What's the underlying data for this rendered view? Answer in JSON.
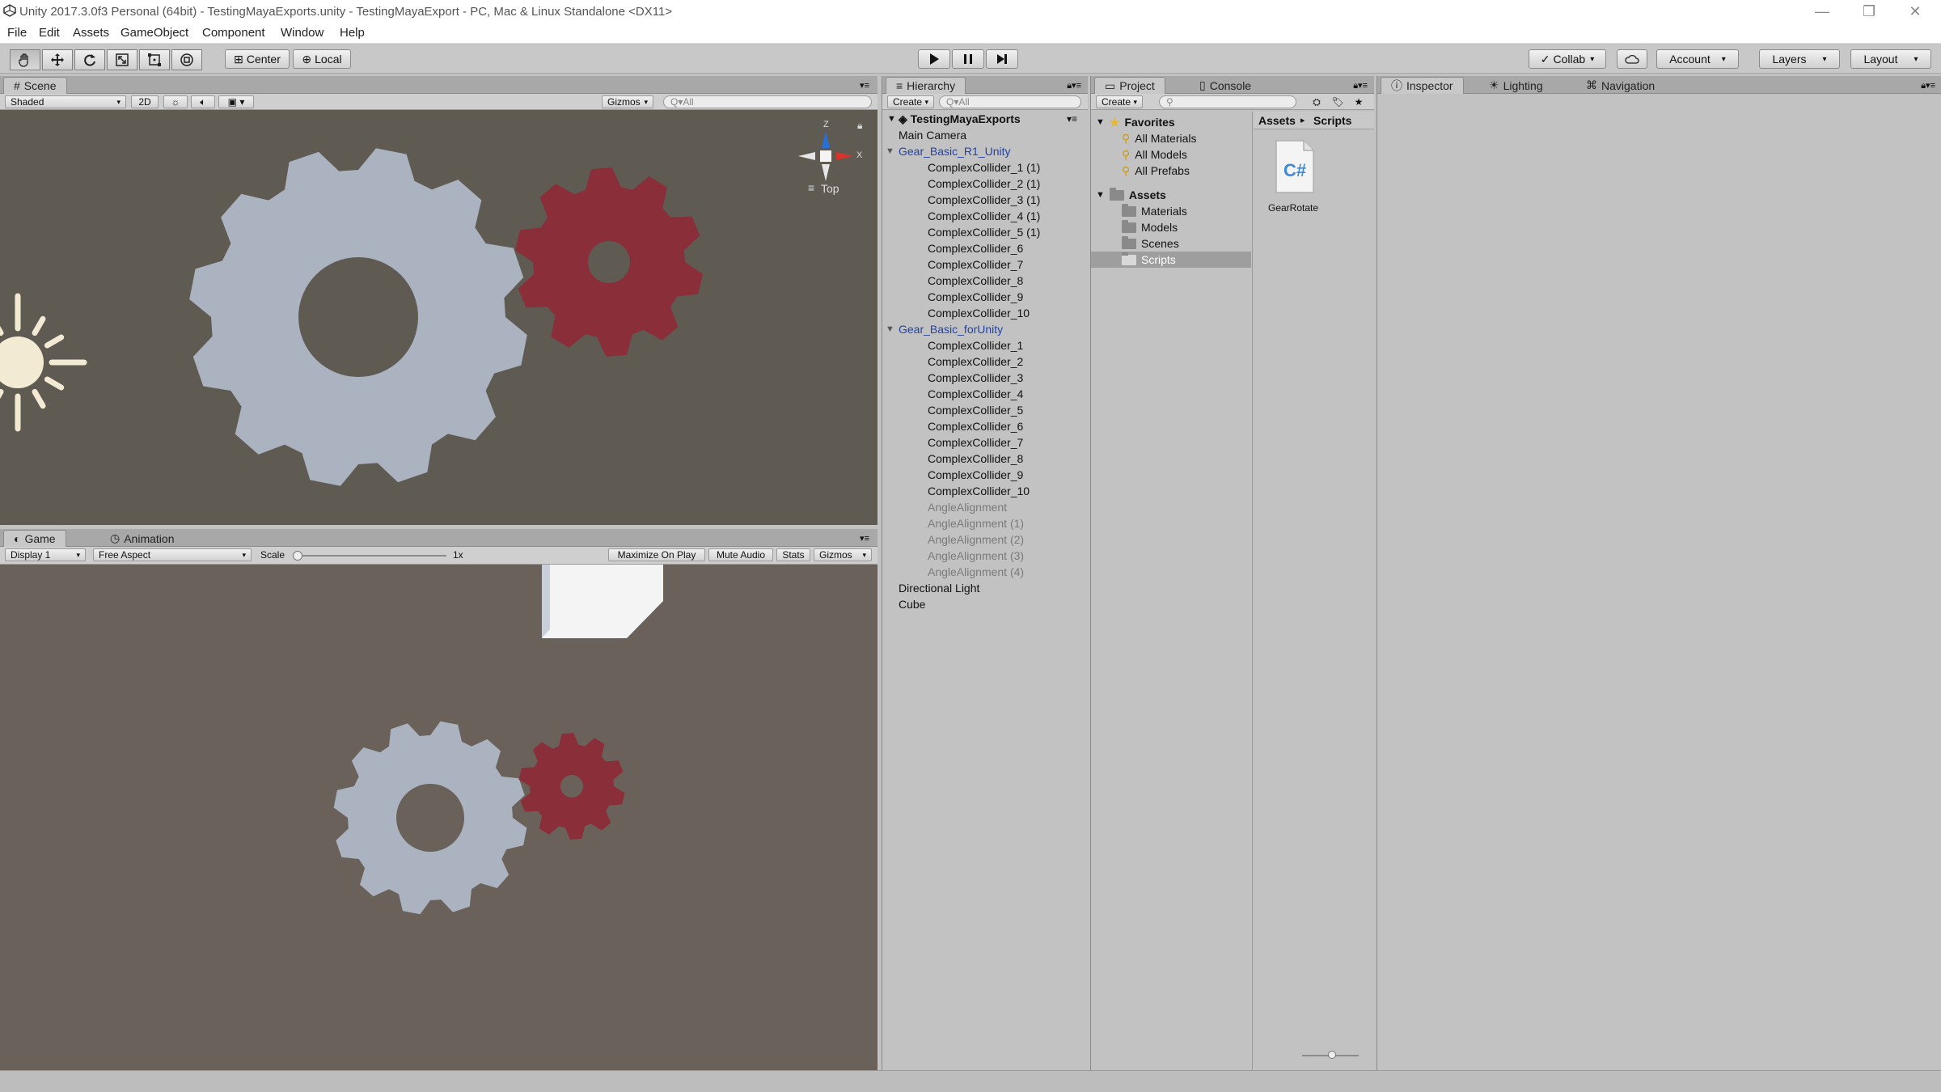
{
  "window": {
    "title": "Unity 2017.3.0f3 Personal (64bit) - TestingMayaExports.unity - TestingMayaExport - PC, Mac & Linux Standalone <DX11>",
    "minimize_glyph": "—",
    "restore_glyph": "❐",
    "close_glyph": "✕"
  },
  "menu": [
    "File",
    "Edit",
    "Assets",
    "GameObject",
    "Component",
    "Window",
    "Help"
  ],
  "toolbar": {
    "pivot_label": "Center",
    "space_label": "Local",
    "collab_label": "Collab",
    "account_label": "Account",
    "layers_label": "Layers",
    "layout_label": "Layout",
    "tools": [
      "hand-tool-icon",
      "move-tool-icon",
      "rotate-tool-icon",
      "scale-tool-icon",
      "rect-tool-icon",
      "transform-tool-icon"
    ]
  },
  "scene": {
    "tab_label": "Scene",
    "shading_mode": "Shaded",
    "mode_2d": "2D",
    "gizmos_label": "Gizmos",
    "search_placeholder": "Q▾All",
    "gizmo_view_label": "Top",
    "axis_y": "Z",
    "axis_x": "X"
  },
  "game": {
    "tab_label": "Game",
    "animation_tab_label": "Animation",
    "display_label": "Display 1",
    "aspect_label": "Free Aspect",
    "scale_label": "Scale",
    "scale_value": "1x",
    "maximize_label": "Maximize On Play",
    "mute_label": "Mute Audio",
    "stats_label": "Stats",
    "gizmos_label": "Gizmos"
  },
  "hierarchy": {
    "tab_label": "Hierarchy",
    "create_label": "Create",
    "search_placeholder": "Q▾All",
    "scene_name": "TestingMayaExports",
    "items": [
      {
        "label": "Main Camera",
        "indent": 1,
        "style": "normal"
      },
      {
        "label": "Gear_Basic_R1_Unity",
        "indent": 1,
        "style": "blue",
        "expanded": true
      },
      {
        "label": "ComplexCollider_1 (1)",
        "indent": 2,
        "style": "normal"
      },
      {
        "label": "ComplexCollider_2 (1)",
        "indent": 2,
        "style": "normal"
      },
      {
        "label": "ComplexCollider_3 (1)",
        "indent": 2,
        "style": "normal"
      },
      {
        "label": "ComplexCollider_4 (1)",
        "indent": 2,
        "style": "normal"
      },
      {
        "label": "ComplexCollider_5 (1)",
        "indent": 2,
        "style": "normal"
      },
      {
        "label": "ComplexCollider_6",
        "indent": 2,
        "style": "normal"
      },
      {
        "label": "ComplexCollider_7",
        "indent": 2,
        "style": "normal"
      },
      {
        "label": "ComplexCollider_8",
        "indent": 2,
        "style": "normal"
      },
      {
        "label": "ComplexCollider_9",
        "indent": 2,
        "style": "normal"
      },
      {
        "label": "ComplexCollider_10",
        "indent": 2,
        "style": "normal"
      },
      {
        "label": "Gear_Basic_forUnity",
        "indent": 1,
        "style": "blue",
        "expanded": true
      },
      {
        "label": "ComplexCollider_1",
        "indent": 2,
        "style": "normal"
      },
      {
        "label": "ComplexCollider_2",
        "indent": 2,
        "style": "normal"
      },
      {
        "label": "ComplexCollider_3",
        "indent": 2,
        "style": "normal"
      },
      {
        "label": "ComplexCollider_4",
        "indent": 2,
        "style": "normal"
      },
      {
        "label": "ComplexCollider_5",
        "indent": 2,
        "style": "normal"
      },
      {
        "label": "ComplexCollider_6",
        "indent": 2,
        "style": "normal"
      },
      {
        "label": "ComplexCollider_7",
        "indent": 2,
        "style": "normal"
      },
      {
        "label": "ComplexCollider_8",
        "indent": 2,
        "style": "normal"
      },
      {
        "label": "ComplexCollider_9",
        "indent": 2,
        "style": "normal"
      },
      {
        "label": "ComplexCollider_10",
        "indent": 2,
        "style": "normal"
      },
      {
        "label": "AngleAlignment",
        "indent": 2,
        "style": "grey"
      },
      {
        "label": "AngleAlignment (1)",
        "indent": 2,
        "style": "grey"
      },
      {
        "label": "AngleAlignment (2)",
        "indent": 2,
        "style": "grey"
      },
      {
        "label": "AngleAlignment (3)",
        "indent": 2,
        "style": "grey"
      },
      {
        "label": "AngleAlignment (4)",
        "indent": 2,
        "style": "grey"
      },
      {
        "label": "Directional Light",
        "indent": 1,
        "style": "normal"
      },
      {
        "label": "Cube",
        "indent": 1,
        "style": "normal"
      }
    ]
  },
  "project": {
    "tab_label": "Project",
    "console_tab_label": "Console",
    "create_label": "Create",
    "favorites_label": "Favorites",
    "favorites": [
      "All Materials",
      "All Models",
      "All Prefabs"
    ],
    "assets_label": "Assets",
    "asset_folders": [
      "Materials",
      "Models",
      "Scenes",
      "Scripts"
    ],
    "selected_folder": "Scripts",
    "breadcrumb_root": "Assets",
    "breadcrumb_separator": "▸",
    "breadcrumb_current": "Scripts",
    "file_name": "GearRotate",
    "file_icon_text": "C#"
  },
  "inspector": {
    "tab_label": "Inspector",
    "lighting_tab_label": "Lighting",
    "navigation_tab_label": "Navigation"
  },
  "colors": {
    "scene_bg": "#5f5a52",
    "game_bg": "#6a625a",
    "gear_grey": "#aab3bf",
    "gear_red": "#8a2e3a",
    "sun": "#f3ead3"
  }
}
